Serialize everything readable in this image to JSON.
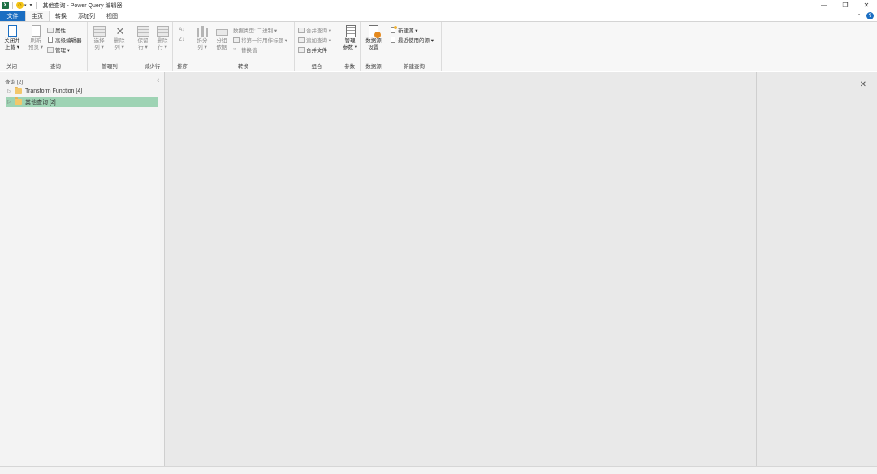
{
  "titlebar": {
    "title": "其他查询 - Power Query 编辑器",
    "app_logo": "X",
    "qa_more": "▾",
    "controls": {
      "minimize": "—",
      "restore": "❐",
      "close": "✕"
    }
  },
  "tabs": [
    {
      "label": "文件"
    },
    {
      "label": "主页"
    },
    {
      "label": "转换"
    },
    {
      "label": "添加列"
    },
    {
      "label": "视图"
    }
  ],
  "ribbon": {
    "close_group": {
      "label": "关闭",
      "close_load": "关闭并",
      "close_load2": "上载 ▾"
    },
    "query_group": {
      "label": "查询",
      "refresh": "刷新",
      "refresh2": "预览 ▾",
      "properties": "属性",
      "advanced_editor": "高级编辑器",
      "manage": "管理 ▾"
    },
    "manage_cols_group": {
      "label": "管理列",
      "choose_cols": "选择",
      "choose_cols2": "列 ▾",
      "remove_cols": "删除",
      "remove_cols2": "列 ▾"
    },
    "reduce_rows_group": {
      "label": "减少行",
      "keep_rows": "保留",
      "keep_rows2": "行 ▾",
      "remove_rows": "删除",
      "remove_rows2": "行 ▾"
    },
    "sort_group": {
      "label": "排序",
      "asc": "A↓",
      "desc": "Z↓"
    },
    "transform_group": {
      "label": "转换",
      "split": "拆分",
      "split2": "列 ▾",
      "group_by": "分组",
      "group_by2": "依据",
      "data_type": "数据类型: 二进制 ▾",
      "first_row_header": "将第一行用作标题 ▾",
      "replace_values": "替换值"
    },
    "combine_group": {
      "label": "组合",
      "merge": "合并查询 ▾",
      "append": "追加查询 ▾",
      "combine_files": "合并文件"
    },
    "params_group": {
      "label": "参数",
      "manage_params": "管理",
      "manage_params2": "参数 ▾"
    },
    "datasource_group": {
      "label": "数据源",
      "settings": "数据源",
      "settings2": "设置"
    },
    "newquery_group": {
      "label": "新建查询",
      "new_source": "新建源 ▾",
      "recent_sources": "最近使用的源 ▾"
    }
  },
  "query_pane": {
    "header": "查询 [2]",
    "collapse": "‹",
    "items": [
      {
        "label": "Transform Function [4]",
        "caret": "▷"
      },
      {
        "label": "其他查询 [2]",
        "caret": "▷"
      }
    ]
  },
  "settings_pane": {
    "close": "✕"
  },
  "help": "?",
  "collapse_ribbon": "⌃"
}
